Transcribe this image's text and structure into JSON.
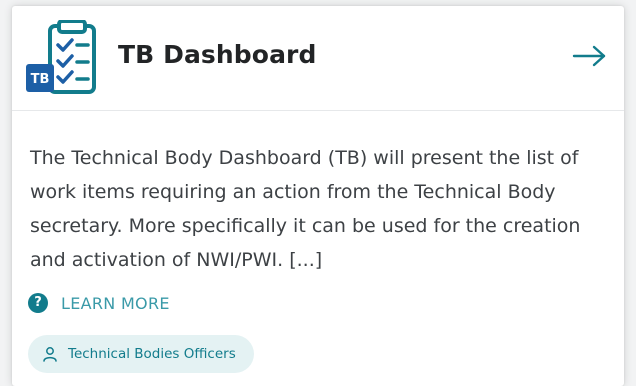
{
  "card": {
    "title": "TB Dashboard",
    "logo_icon": "checklist-clipboard-icon",
    "logo_badge": "TB",
    "arrow_icon": "arrow-right-icon",
    "description": "The Technical Body Dashboard (TB) will present the list of work items requiring an action from the Technical Body secretary. More specifically it can be used for the creation and activation of NWI/PWI. [...]",
    "learn_more": {
      "icon": "question-circle-icon",
      "icon_glyph": "?",
      "label": "LEARN MORE"
    },
    "tag": {
      "icon": "user-icon",
      "label": "Technical Bodies Officers"
    }
  },
  "colors": {
    "accent": "#127c8c",
    "accent_light": "#3a9aa8",
    "logo_blue": "#1d5fa6",
    "tag_background": "#e4f2f3",
    "title_text": "#222426",
    "body_text": "#3d4145"
  }
}
